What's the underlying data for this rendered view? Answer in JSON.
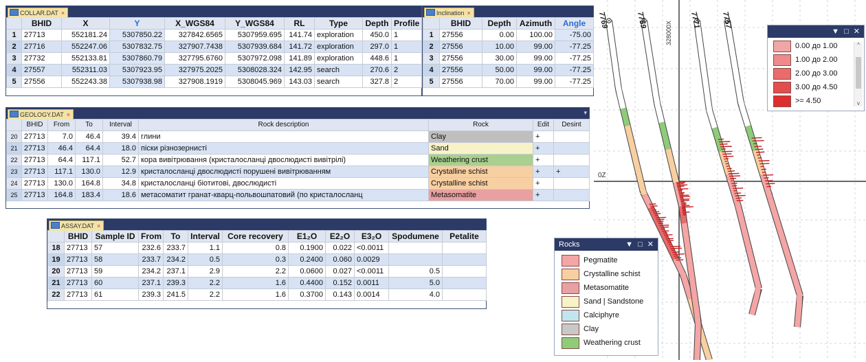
{
  "collar": {
    "tab": "COLLAR.DAT",
    "columns": [
      "BHID",
      "X",
      "Y",
      "X_WGS84",
      "Y_WGS84",
      "RL",
      "Type",
      "Depth",
      "Profile"
    ],
    "rows": [
      {
        "n": "1",
        "c": [
          "27713",
          "552181.24",
          "5307850.22",
          "327842.6565",
          "5307959.695",
          "141.74",
          "exploration",
          "450.0",
          "1"
        ]
      },
      {
        "n": "2",
        "c": [
          "27716",
          "552247.06",
          "5307832.75",
          "327907.7438",
          "5307939.684",
          "141.72",
          "exploration",
          "297.0",
          "1"
        ]
      },
      {
        "n": "3",
        "c": [
          "27732",
          "552133.81",
          "5307860.79",
          "327795.6760",
          "5307972.098",
          "141.89",
          "exploration",
          "448.6",
          "1"
        ]
      },
      {
        "n": "4",
        "c": [
          "27557",
          "552311.03",
          "5307923.95",
          "327975.2025",
          "5308028.324",
          "142.95",
          "search",
          "270.6",
          "2"
        ]
      },
      {
        "n": "5",
        "c": [
          "27556",
          "552243.38",
          "5307938.98",
          "327908.1919",
          "5308045.969",
          "143.03",
          "search",
          "327.8",
          "2"
        ]
      }
    ]
  },
  "inclination": {
    "tab": "Inclination",
    "columns": [
      "BHID",
      "Depth",
      "Azimuth",
      "Angle"
    ],
    "rows": [
      {
        "n": "1",
        "c": [
          "27556",
          "0.00",
          "100.00",
          "-75.00"
        ]
      },
      {
        "n": "2",
        "c": [
          "27556",
          "10.00",
          "99.00",
          "-77.25"
        ]
      },
      {
        "n": "3",
        "c": [
          "27556",
          "30.00",
          "99.00",
          "-77.25"
        ]
      },
      {
        "n": "4",
        "c": [
          "27556",
          "50.00",
          "99.00",
          "-77.25"
        ]
      },
      {
        "n": "5",
        "c": [
          "27556",
          "70.00",
          "99.00",
          "-77.25"
        ]
      }
    ]
  },
  "geology": {
    "tab": "GEOLOGY.DAT",
    "columns": [
      "BHID",
      "From",
      "To",
      "Interval",
      "Rock description",
      "Rock",
      "Edit",
      "Desint"
    ],
    "rows": [
      {
        "n": "20",
        "c": [
          "27713",
          "7.0",
          "46.4",
          "39.4",
          "глини",
          "Clay",
          "+",
          ""
        ],
        "color": "#bfbfbf"
      },
      {
        "n": "21",
        "c": [
          "27713",
          "46.4",
          "64.4",
          "18.0",
          "піски різнозернисті",
          "Sand",
          "+",
          ""
        ],
        "color": "#f8f2c8"
      },
      {
        "n": "22",
        "c": [
          "27713",
          "64.4",
          "117.1",
          "52.7",
          "кора вивітрювання (кристалосланці двослюдисті вивітрілі)",
          "Weathering crust",
          "+",
          ""
        ],
        "color": "#a9d08e"
      },
      {
        "n": "23",
        "c": [
          "27713",
          "117.1",
          "130.0",
          "12.9",
          "кристалосланці двослюдисті порушені вивітрюванням",
          "Crystalline schist",
          "+",
          "+"
        ],
        "color": "#f8cfa0"
      },
      {
        "n": "24",
        "c": [
          "27713",
          "130.0",
          "164.8",
          "34.8",
          "кристалосланці біотитові, двослюдисті",
          "Crystalline schist",
          "+",
          ""
        ],
        "color": "#f8cfa0"
      },
      {
        "n": "25",
        "c": [
          "27713",
          "164.8",
          "183.4",
          "18.6",
          "метасоматит гранат-кварц-польвошпатовий (по кристалосланц",
          "Metasomatite",
          "+",
          ""
        ],
        "color": "#e8a0a0"
      }
    ]
  },
  "assay": {
    "tab": "ASSAY.DAT",
    "columns": [
      "BHID",
      "Sample ID",
      "From",
      "To",
      "Interval",
      "Core recovery",
      "E1₂O",
      "E2₂O",
      "E3₂O",
      "Spodumene",
      "Petalite"
    ],
    "rows": [
      {
        "n": "18",
        "c": [
          "27713",
          "57",
          "232.6",
          "233.7",
          "1.1",
          "0.8",
          "0.1900",
          "0.022",
          "<0.0011",
          "",
          ""
        ]
      },
      {
        "n": "19",
        "c": [
          "27713",
          "58",
          "233.7",
          "234.2",
          "0.5",
          "0.3",
          "0.2400",
          "0.060",
          "0.0029",
          "",
          ""
        ]
      },
      {
        "n": "20",
        "c": [
          "27713",
          "59",
          "234.2",
          "237.1",
          "2.9",
          "2.2",
          "0.0600",
          "0.027",
          "<0.0011",
          "0.5",
          ""
        ]
      },
      {
        "n": "21",
        "c": [
          "27713",
          "60",
          "237.1",
          "239.3",
          "2.2",
          "1.6",
          "0.4400",
          "0.152",
          "0.0011",
          "5.0",
          ""
        ]
      },
      {
        "n": "22",
        "c": [
          "27713",
          "61",
          "239.3",
          "241.5",
          "2.2",
          "1.6",
          "0.3700",
          "0.143",
          "0.0014",
          "4.0",
          ""
        ]
      }
    ]
  },
  "section": {
    "hole_labels": [
      "7769",
      "7759",
      "7771",
      "7757"
    ],
    "x_coord_label": "328000X",
    "z_label": "0Z"
  },
  "grade_legend": {
    "controls": "▼ □ ✕",
    "items": [
      {
        "label": "0.00 до 1.00",
        "color": "#f2a5a5"
      },
      {
        "label": "1.00 до 2.00",
        "color": "#ee8a8a"
      },
      {
        "label": "2.00 до 3.00",
        "color": "#e86c6c"
      },
      {
        "label": "3.00 до 4.50",
        "color": "#e24d4d"
      },
      {
        "label": ">= 4.50",
        "color": "#dc2e2e"
      }
    ]
  },
  "rocks_legend": {
    "title": "Rocks",
    "controls": "▼ □ ✕",
    "items": [
      {
        "label": "Pegmatite",
        "color": "#f4a5a5"
      },
      {
        "label": "Crystalline schist",
        "color": "#f8cfa0"
      },
      {
        "label": "Metasomatite",
        "color": "#e8a0a0"
      },
      {
        "label": "Sand | Sandstone",
        "color": "#f8f2c8"
      },
      {
        "label": "Calciphyre",
        "color": "#bfe6ee"
      },
      {
        "label": "Clay",
        "color": "#c8c8c8"
      },
      {
        "label": "Weathering crust",
        "color": "#8fcc7a"
      }
    ]
  }
}
